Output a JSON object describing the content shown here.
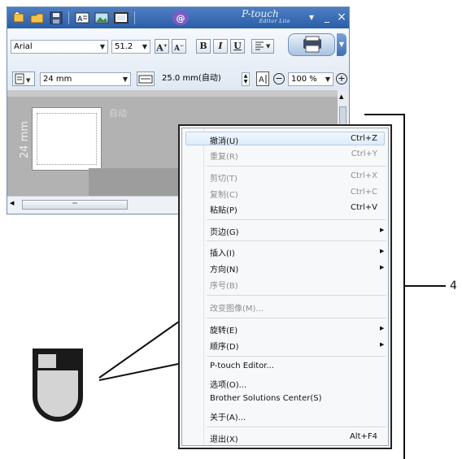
{
  "window": {
    "brand_main": "P-touch",
    "brand_sub": "Editor Lite",
    "title_minimize": "_",
    "title_close": "×",
    "title_dropdown": "▾"
  },
  "toolbar": {
    "font": "Arial",
    "font_size": "51.2",
    "bold": "B",
    "italic": "I",
    "underline": "U",
    "grow_font": "A",
    "shrink_font": "A",
    "tape_width": "24 mm",
    "label_length": "25.0 mm(自动)",
    "zoom": "100 %",
    "zoom_out": "−",
    "zoom_in": "+"
  },
  "canvas": {
    "ruler_label": "24 mm",
    "auto_text": "自动",
    "scroll_thumb": "'''"
  },
  "context_menu": {
    "items": [
      {
        "label": "撤消(U)",
        "shortcut": "Ctrl+Z",
        "enabled": true
      },
      {
        "label": "重复(R)",
        "shortcut": "Ctrl+Y",
        "enabled": false
      },
      {
        "label": "剪切(T)",
        "shortcut": "Ctrl+X",
        "enabled": false
      },
      {
        "label": "复制(C)",
        "shortcut": "Ctrl+C",
        "enabled": false
      },
      {
        "label": "粘贴(P)",
        "shortcut": "Ctrl+V",
        "enabled": true
      },
      {
        "label": "页边(G)",
        "submenu": true,
        "enabled": true
      },
      {
        "label": "插入(I)",
        "submenu": true,
        "enabled": true
      },
      {
        "label": "方向(N)",
        "submenu": true,
        "enabled": true
      },
      {
        "label": "序号(B)",
        "enabled": false
      },
      {
        "label": "改变图像(M)...",
        "enabled": false
      },
      {
        "label": "旋转(E)",
        "submenu": true,
        "enabled": true
      },
      {
        "label": "顺序(D)",
        "submenu": true,
        "enabled": true
      },
      {
        "label": "P-touch Editor...",
        "enabled": true
      },
      {
        "label": "选项(O)...",
        "enabled": true
      },
      {
        "label": "Brother Solutions Center(S)",
        "enabled": true
      },
      {
        "label": "关于(A)...",
        "enabled": true
      },
      {
        "label": "退出(X)",
        "shortcut": "Alt+F4",
        "enabled": true
      }
    ],
    "submenu_arrow": "▶"
  },
  "callout": {
    "number": "4"
  },
  "colors": {
    "title_bar": "#2a5ea8",
    "canvas_gray": "#b2b2b2",
    "mouse_body": "#d0d0d0",
    "mouse_outline": "#222222"
  },
  "icons": [
    "new-icon",
    "open-icon",
    "save-icon",
    "text-icon",
    "image-icon",
    "frame-icon",
    "help-icon",
    "print-icon",
    "mouse-right-click-icon"
  ]
}
